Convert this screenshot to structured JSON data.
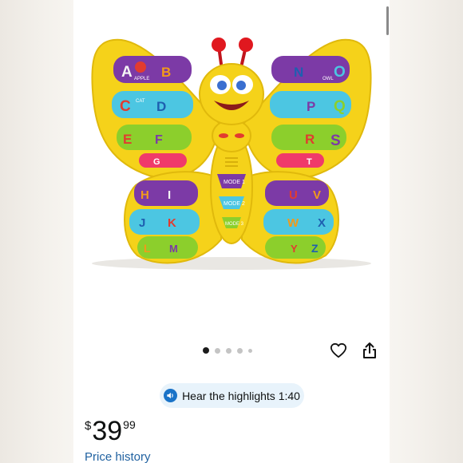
{
  "product": {
    "image_alt": "Yellow butterfly alphabet learning toy",
    "mode_buttons": [
      "MODE 1",
      "MODE 2",
      "MODE 3"
    ],
    "left_keys": [
      "A",
      "B",
      "C",
      "D",
      "E",
      "F",
      "G",
      "H",
      "I",
      "J",
      "K",
      "L",
      "M"
    ],
    "right_keys": [
      "N",
      "O",
      "P",
      "Q",
      "R",
      "S",
      "T",
      "U",
      "V",
      "W",
      "X",
      "Y",
      "Z"
    ],
    "word_labels": {
      "apple": "APPLE",
      "cat": "CAT",
      "owl": "OWL"
    }
  },
  "carousel": {
    "count": 5,
    "active_index": 0
  },
  "actions": {
    "wishlist_icon": "heart-icon",
    "share_icon": "share-icon"
  },
  "highlights": {
    "label": "Hear the highlights 1:40",
    "icon": "speaker-icon"
  },
  "price": {
    "symbol": "$",
    "whole": "39",
    "fraction": "99"
  },
  "links": {
    "price_history": "Price history"
  },
  "colors": {
    "toy_yellow": "#f5d21a",
    "link_blue": "#2162a1",
    "pill_bg": "#e8f3fb"
  }
}
